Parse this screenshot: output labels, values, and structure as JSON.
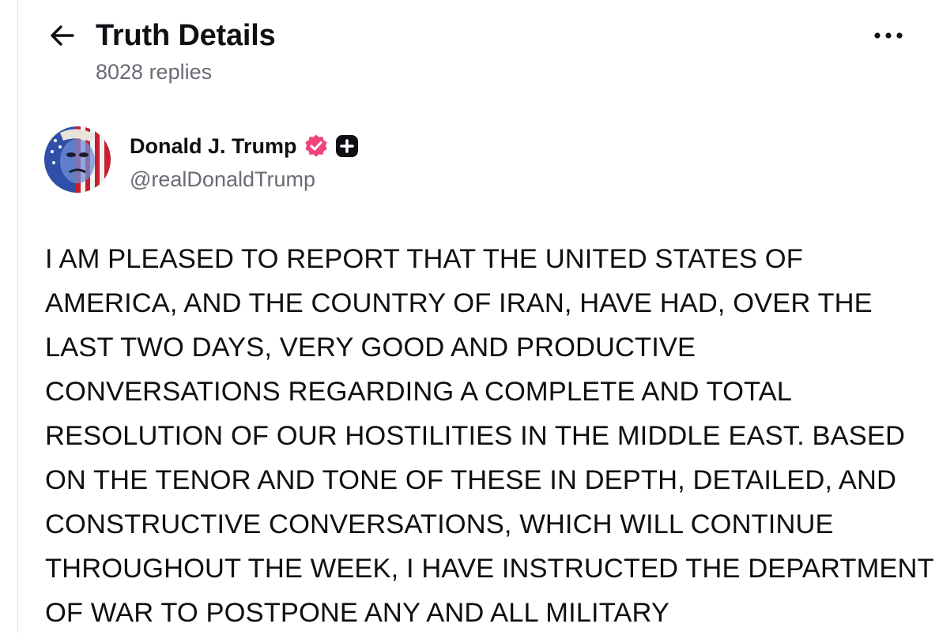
{
  "header": {
    "back_icon": "arrow-left-icon",
    "title": "Truth Details",
    "replies": "8028 replies",
    "more_icon": "ellipsis-horizontal-icon"
  },
  "post": {
    "author": {
      "name": "Donald J. Trump",
      "handle": "@realDonaldTrump",
      "verified_icon": "verified-badge-icon",
      "verified_color": "#f0447a",
      "plus_icon": "plus-badge-icon"
    },
    "text": "I AM PLEASED TO REPORT THAT THE UNITED STATES OF AMERICA, AND THE COUNTRY OF IRAN, HAVE HAD, OVER THE LAST TWO DAYS, VERY GOOD AND PRODUCTIVE CONVERSATIONS REGARDING A COMPLETE AND TOTAL RESOLUTION OF OUR HOSTILITIES IN THE MIDDLE EAST. BASED ON THE TENOR AND TONE OF THESE IN DEPTH, DETAILED, AND CONSTRUCTIVE CONVERSATIONS, WHICH WILL CONTINUE THROUGHOUT THE WEEK, I HAVE INSTRUCTED THE DEPARTMENT OF WAR TO POSTPONE ANY AND ALL MILITARY"
  },
  "colors": {
    "text_primary": "#0f0f14",
    "text_secondary": "#6a6a74",
    "background": "#ffffff"
  }
}
